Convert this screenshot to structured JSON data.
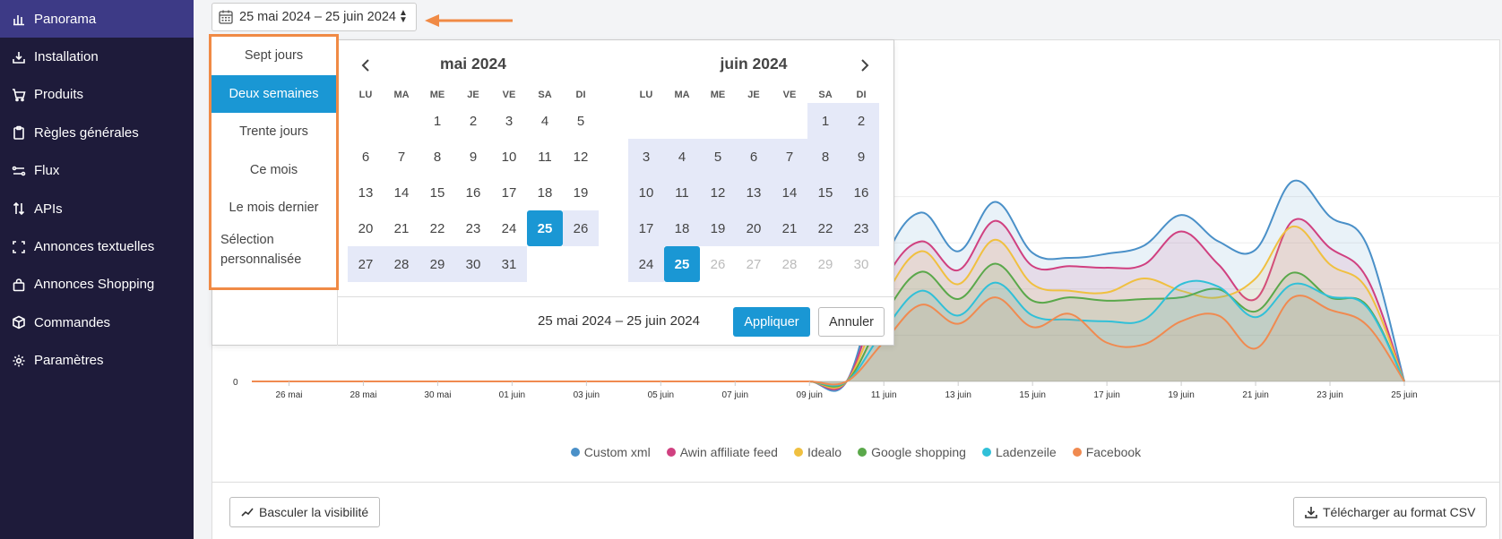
{
  "sidebar": {
    "items": [
      {
        "label": "Panorama",
        "icon": "bar-chart-icon",
        "active": true
      },
      {
        "label": "Installation",
        "icon": "download-icon"
      },
      {
        "label": "Produits",
        "icon": "cart-icon"
      },
      {
        "label": "Règles générales",
        "icon": "clipboard-icon"
      },
      {
        "label": "Flux",
        "icon": "flow-icon"
      },
      {
        "label": "APIs",
        "icon": "arrows-icon"
      },
      {
        "label": "Annonces textuelles",
        "icon": "frame-icon"
      },
      {
        "label": "Annonces Shopping",
        "icon": "shopping-bag-icon"
      },
      {
        "label": "Commandes",
        "icon": "box-icon"
      },
      {
        "label": "Paramètres",
        "icon": "gear-icon"
      }
    ]
  },
  "date_trigger": {
    "label": "25 mai 2024 – 25 juin 2024"
  },
  "picker": {
    "ranges": [
      "Sept jours",
      "Deux semaines",
      "Trente jours",
      "Ce mois",
      "Le mois dernier",
      "Sélection personnalisée"
    ],
    "active_range": 1,
    "dow": [
      "LU",
      "MA",
      "ME",
      "JE",
      "VE",
      "SA",
      "DI"
    ],
    "left_month": {
      "title": "mai 2024",
      "weeks": [
        [
          "",
          "",
          "1",
          "2",
          "3",
          "4",
          "5"
        ],
        [
          "6",
          "7",
          "8",
          "9",
          "10",
          "11",
          "12"
        ],
        [
          "13",
          "14",
          "15",
          "16",
          "17",
          "18",
          "19"
        ],
        [
          "20",
          "21",
          "22",
          "23",
          "24",
          "25",
          "26"
        ],
        [
          "27",
          "28",
          "29",
          "30",
          "31",
          "",
          ""
        ]
      ]
    },
    "right_month": {
      "title": "juin 2024",
      "weeks": [
        [
          "",
          "",
          "",
          "",
          "",
          "1",
          "2"
        ],
        [
          "3",
          "4",
          "5",
          "6",
          "7",
          "8",
          "9"
        ],
        [
          "10",
          "11",
          "12",
          "13",
          "14",
          "15",
          "16"
        ],
        [
          "17",
          "18",
          "19",
          "20",
          "21",
          "22",
          "23"
        ],
        [
          "24",
          "25",
          "26",
          "27",
          "28",
          "29",
          "30"
        ]
      ]
    },
    "range_text": "25 mai 2024 – 25 juin 2024",
    "apply_label": "Appliquer",
    "cancel_label": "Annuler"
  },
  "chart_data": {
    "type": "area",
    "x": [
      "25 mai",
      "26 mai",
      "27 mai",
      "28 mai",
      "29 mai",
      "30 mai",
      "31 mai",
      "01 juin",
      "02 juin",
      "03 juin",
      "04 juin",
      "05 juin",
      "06 juin",
      "07 juin",
      "08 juin",
      "09 juin",
      "10 juin",
      "11 juin",
      "12 juin",
      "13 juin",
      "14 juin",
      "15 juin",
      "16 juin",
      "17 juin",
      "18 juin",
      "19 juin",
      "20 juin",
      "21 juin",
      "22 juin",
      "23 juin",
      "24 juin",
      "25 juin"
    ],
    "tick_labels": [
      "26 mai",
      "28 mai",
      "30 mai",
      "01 juin",
      "03 juin",
      "05 juin",
      "07 juin",
      "09 juin",
      "11 juin",
      "13 juin",
      "15 juin",
      "17 juin",
      "19 juin",
      "21 juin",
      "23 juin",
      "25 juin"
    ],
    "y_tick_labels": [
      "0"
    ],
    "series": [
      {
        "name": "Custom xml",
        "color": "#4a90c8",
        "values": [
          0,
          0,
          0,
          0,
          0,
          0,
          0,
          0,
          0,
          0,
          0,
          0,
          0,
          0,
          0,
          0,
          0,
          145,
          205,
          158,
          218,
          156,
          150,
          155,
          165,
          202,
          170,
          160,
          243,
          200,
          165,
          0
        ]
      },
      {
        "name": "Awin affiliate feed",
        "color": "#d04080",
        "values": [
          0,
          0,
          0,
          0,
          0,
          0,
          0,
          0,
          0,
          0,
          0,
          0,
          0,
          0,
          0,
          0,
          0,
          120,
          170,
          135,
          195,
          140,
          140,
          138,
          142,
          182,
          142,
          100,
          195,
          162,
          125,
          0
        ]
      },
      {
        "name": "Idealo",
        "color": "#f0c040",
        "values": [
          0,
          0,
          0,
          0,
          0,
          0,
          0,
          0,
          0,
          0,
          0,
          0,
          0,
          0,
          0,
          0,
          0,
          100,
          158,
          118,
          172,
          118,
          110,
          108,
          125,
          110,
          102,
          125,
          188,
          142,
          112,
          0
        ]
      },
      {
        "name": "Google shopping",
        "color": "#5aa84a",
        "values": [
          0,
          0,
          0,
          0,
          0,
          0,
          0,
          0,
          0,
          0,
          0,
          0,
          0,
          0,
          0,
          0,
          0,
          80,
          133,
          100,
          143,
          98,
          102,
          98,
          100,
          102,
          112,
          85,
          132,
          102,
          92,
          0
        ]
      },
      {
        "name": "Ladenzeile",
        "color": "#30c0d8",
        "values": [
          0,
          0,
          0,
          0,
          0,
          0,
          0,
          0,
          0,
          0,
          0,
          0,
          0,
          0,
          0,
          0,
          0,
          62,
          110,
          80,
          120,
          80,
          75,
          73,
          75,
          118,
          115,
          78,
          118,
          103,
          90,
          0
        ]
      },
      {
        "name": "Facebook",
        "color": "#f08a50",
        "values": [
          0,
          0,
          0,
          0,
          0,
          0,
          0,
          0,
          0,
          0,
          0,
          0,
          0,
          0,
          0,
          0,
          0,
          48,
          93,
          70,
          102,
          66,
          82,
          47,
          45,
          73,
          80,
          40,
          102,
          87,
          68,
          0
        ]
      }
    ]
  },
  "toggle_button": {
    "label": "Basculer la visibilité"
  },
  "csv_button": {
    "label": "Télécharger au format CSV"
  }
}
